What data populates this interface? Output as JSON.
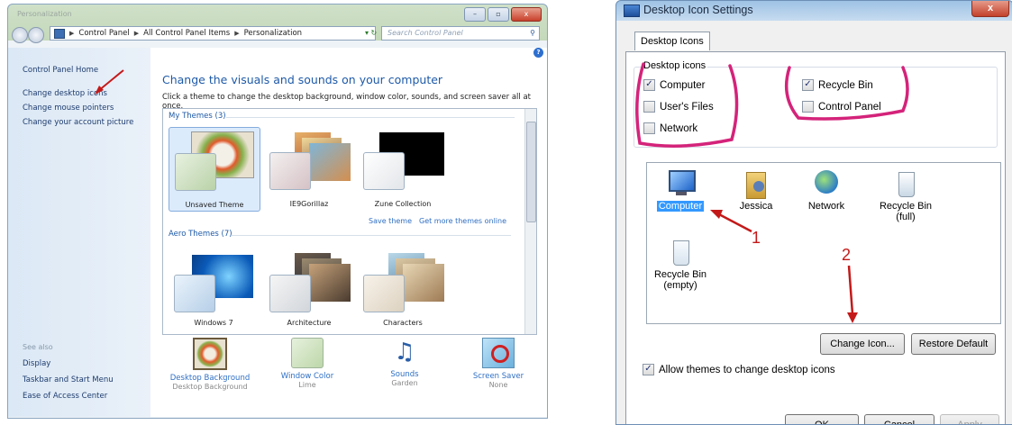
{
  "personalization": {
    "titlebar_blur": "Personalization",
    "window_controls": [
      "–",
      "▫",
      "x"
    ],
    "address_crumbs": [
      "Control Panel",
      "All Control Panel Items",
      "Personalization"
    ],
    "search_placeholder": "Search Control Panel",
    "left_links": [
      "Control Panel Home",
      "Change desktop icons",
      "Change mouse pointers",
      "Change your account picture"
    ],
    "see_also_label": "See also",
    "see_also_links": [
      "Display",
      "Taskbar and Start Menu",
      "Ease of Access Center"
    ],
    "heading": "Change the visuals and sounds on your computer",
    "subheading": "Click a theme to change the desktop background, window color, sounds, and screen saver all at once.",
    "my_themes_header": "My Themes (3)",
    "my_themes": [
      "Unsaved Theme",
      "IE9Gorillaz",
      "Zune Collection"
    ],
    "save_theme": "Save theme",
    "get_more_themes": "Get more themes online",
    "aero_themes_header": "Aero Themes (7)",
    "aero_themes": [
      "Windows 7",
      "Architecture",
      "Characters"
    ],
    "bottom_items": [
      {
        "title": "Desktop Background",
        "value": "Desktop Background"
      },
      {
        "title": "Window Color",
        "value": "Lime"
      },
      {
        "title": "Sounds",
        "value": "Garden"
      },
      {
        "title": "Screen Saver",
        "value": "None"
      }
    ]
  },
  "dialog": {
    "title": "Desktop Icon Settings",
    "close_label": "x",
    "tab": "Desktop Icons",
    "group_label": "Desktop icons",
    "checkboxes": [
      {
        "label": "Computer",
        "checked": true
      },
      {
        "label": "User's Files",
        "checked": false
      },
      {
        "label": "Network",
        "checked": false
      },
      {
        "label": "Recycle Bin",
        "checked": true
      },
      {
        "label": "Control Panel",
        "checked": false
      }
    ],
    "icons": [
      {
        "label": "Computer",
        "icon": "computer-icon"
      },
      {
        "label": "Jessica",
        "icon": "user-folder-icon"
      },
      {
        "label": "Network",
        "icon": "network-icon"
      },
      {
        "label": "Recycle Bin\n(full)",
        "icon": "recycle-bin-full-icon"
      },
      {
        "label": "Recycle Bin\n(empty)",
        "icon": "recycle-bin-empty-icon"
      }
    ],
    "change_icon": "Change Icon...",
    "restore_default": "Restore Default",
    "allow_themes": "Allow themes to change desktop icons",
    "ok": "OK",
    "cancel": "Cancel",
    "apply": "Apply"
  },
  "annotations": {
    "one": "1",
    "two": "2"
  },
  "colors": {
    "annotation_red": "#c41919",
    "circle_pink": "#d4237a",
    "link_blue": "#1e5aa8",
    "selection_blue": "#3399ff"
  }
}
